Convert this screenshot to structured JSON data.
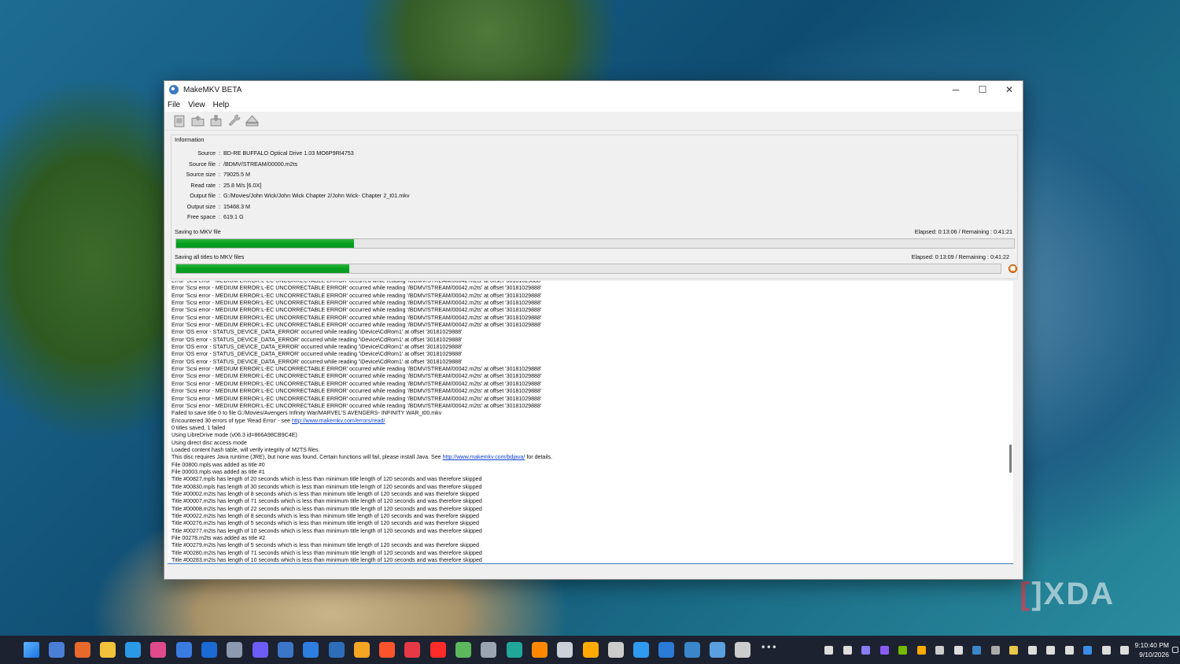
{
  "window": {
    "title": "MakeMKV BETA",
    "controls": {
      "minimize": "─",
      "maximize": "☐",
      "close": "✕"
    }
  },
  "menu": [
    "File",
    "View",
    "Help"
  ],
  "toolbar": [
    "open-disc-icon",
    "open-files-icon",
    "backup-icon",
    "preferences-icon",
    "eject-icon"
  ],
  "info": {
    "heading": "Information",
    "rows": [
      {
        "label": "Source",
        "value": "BD-RE BUFFALO Optical Drive 1.03 MO6P9RI4753"
      },
      {
        "label": "Source file",
        "value": "/BDMV/STREAM/00000.m2ts"
      },
      {
        "label": "Source size",
        "value": "79025.5 M"
      },
      {
        "label": "Read rate",
        "value": "25.8 M/s [6.0X]"
      },
      {
        "label": "Output file",
        "value": "G:/Movies/John Wick/John Wick Chapter 2/John Wick- Chapter 2_t01.mkv"
      },
      {
        "label": "Output size",
        "value": "15468.3 M"
      },
      {
        "label": "Free space",
        "value": "619.1 G"
      }
    ],
    "separator": ":"
  },
  "progress": [
    {
      "label": "Saving to MKV file",
      "time": "Elapsed: 0:13:06 / Remaining : 0:41:21",
      "fraction": 0.212
    },
    {
      "label": "Saving all titles to MKV files",
      "time": "Elapsed: 0:13:09 / Remaining : 0:41:22",
      "fraction": 0.21
    }
  ],
  "log": [
    "Error 'Scsi error - MEDIUM ERROR:L-EC UNCORRECTABLE ERROR' occurred while reading '/BDMV/STREAM/00042.m2ts' at offset '30181029888'",
    "Error 'Scsi error - MEDIUM ERROR:L-EC UNCORRECTABLE ERROR' occurred while reading '/BDMV/STREAM/00042.m2ts' at offset '30181029888'",
    "Error 'Scsi error - MEDIUM ERROR:L-EC UNCORRECTABLE ERROR' occurred while reading '/BDMV/STREAM/00042.m2ts' at offset '30181029888'",
    "Error 'Scsi error - MEDIUM ERROR:L-EC UNCORRECTABLE ERROR' occurred while reading '/BDMV/STREAM/00042.m2ts' at offset '30181029888'",
    "Error 'Scsi error - MEDIUM ERROR:L-EC UNCORRECTABLE ERROR' occurred while reading '/BDMV/STREAM/00042.m2ts' at offset '30181029888'",
    "Error 'Scsi error - MEDIUM ERROR:L-EC UNCORRECTABLE ERROR' occurred while reading '/BDMV/STREAM/00042.m2ts' at offset '30181029888'",
    "Error 'Scsi error - MEDIUM ERROR:L-EC UNCORRECTABLE ERROR' occurred while reading '/BDMV/STREAM/00042.m2ts' at offset '30181029888'",
    "Error 'OS error - STATUS_DEVICE_DATA_ERROR' occurred while reading '\\Device\\CdRom1' at offset '30181029888'",
    "Error 'OS error - STATUS_DEVICE_DATA_ERROR' occurred while reading '\\Device\\CdRom1' at offset '30181029888'",
    "Error 'OS error - STATUS_DEVICE_DATA_ERROR' occurred while reading '\\Device\\CdRom1' at offset '30181029888'",
    "Error 'OS error - STATUS_DEVICE_DATA_ERROR' occurred while reading '\\Device\\CdRom1' at offset '30181029888'",
    "Error 'OS error - STATUS_DEVICE_DATA_ERROR' occurred while reading '\\Device\\CdRom1' at offset '30181029888'",
    "Error 'Scsi error - MEDIUM ERROR:L-EC UNCORRECTABLE ERROR' occurred while reading '/BDMV/STREAM/00042.m2ts' at offset '30181029888'",
    "Error 'Scsi error - MEDIUM ERROR:L-EC UNCORRECTABLE ERROR' occurred while reading '/BDMV/STREAM/00042.m2ts' at offset '30181029888'",
    "Error 'Scsi error - MEDIUM ERROR:L-EC UNCORRECTABLE ERROR' occurred while reading '/BDMV/STREAM/00042.m2ts' at offset '30181029888'",
    "Error 'Scsi error - MEDIUM ERROR:L-EC UNCORRECTABLE ERROR' occurred while reading '/BDMV/STREAM/00042.m2ts' at offset '30181029888'",
    "Error 'Scsi error - MEDIUM ERROR:L-EC UNCORRECTABLE ERROR' occurred while reading '/BDMV/STREAM/00042.m2ts' at offset '30181029888'",
    "Error 'Scsi error - MEDIUM ERROR:L-EC UNCORRECTABLE ERROR' occurred while reading '/BDMV/STREAM/00042.m2ts' at offset '30181029888'",
    "Failed to save title 0 to file G:/Movies/Avengers Infinity War/MARVEL'S AVENGERS- INFINITY WAR_t00.mkv",
    "Encountered 30 errors of type 'Read Error' - see |http://www.makemkv.com/errors/read/",
    "0 titles saved, 1 failed",
    "Using LibreDrive mode (v06.3 id=866A98CB9C4E)",
    "Using direct disc access mode",
    "Loaded content hash table, will verify integrity of M2TS files.",
    "This disc requires Java runtime (JRE), but none was found. Certain functions will fail, please install Java. See |http://www.makemkv.com/bdjava/| for details.",
    "File 00800.mpls was added as title #0",
    "File 00003.mpls was added as title #1",
    "Title #00827.mpls has length of 20 seconds which is less than minimum title length of 120 seconds and was therefore skipped",
    "Title #00830.mpls has length of 30 seconds which is less than minimum title length of 120 seconds and was therefore skipped",
    "Title #00002.m2ts has length of 8 seconds which is less than minimum title length of 120 seconds and was therefore skipped",
    "Title #00007.m2ts has length of 71 seconds which is less than minimum title length of 120 seconds and was therefore skipped",
    "Title #00008.m2ts has length of 22 seconds which is less than minimum title length of 120 seconds and was therefore skipped",
    "Title #00022.m2ts has length of 8 seconds which is less than minimum title length of 120 seconds and was therefore skipped",
    "Title #00276.m2ts has length of 5 seconds which is less than minimum title length of 120 seconds and was therefore skipped",
    "Title #00277.m2ts has length of 10 seconds which is less than minimum title length of 120 seconds and was therefore skipped",
    "File 00278.m2ts was added as title #2",
    "Title #00279.m2ts has length of 5 seconds which is less than minimum title length of 120 seconds and was therefore skipped",
    "Title #00280.m2ts has length of 71 seconds which is less than minimum title length of 120 seconds and was therefore skipped",
    "Title #00283.m2ts has length of 10 seconds which is less than minimum title length of 120 seconds and was therefore skipped"
  ],
  "watermark": "XDA",
  "taskbar": {
    "apps": [
      "start-icon",
      "widgets-icon",
      "firefox-icon",
      "file-explorer-icon",
      "edge-icon",
      "slack-icon",
      "store-icon",
      "outlook-icon",
      "settings-icon",
      "messenger-icon",
      "calculator-icon",
      "notepad-icon",
      "terminal-icon",
      "app-icon",
      "brave-icon",
      "app-icon",
      "youtube-icon",
      "app-icon",
      "app-icon",
      "app-icon",
      "vlc-icon",
      "app-icon",
      "search-app-icon",
      "app-icon",
      "app-icon",
      "app-icon",
      "app-icon",
      "makemkv-icon",
      "app-icon",
      "more-icon"
    ],
    "app_colors": [
      "#3a8ee6",
      "#4a7fd6",
      "#e8692a",
      "#f2c33a",
      "#2b9ae6",
      "#e04a8c",
      "#3a7be0",
      "#1b6ad6",
      "#8d99ae",
      "#6d5cf5",
      "#3c76c8",
      "#2e7de0",
      "#2c6fb8",
      "#f4a623",
      "#fb542b",
      "#e63946",
      "#ff2a2a",
      "#5bb85d",
      "#9aa5b1",
      "#1fa79a",
      "#ff8800",
      "#c9d1d9",
      "#ffaa00",
      "#cccccc",
      "#2e9bf0",
      "#2a7ad6",
      "#3a86c8",
      "#5aa0e0",
      "#cccccc",
      "#dddddd"
    ],
    "tray": [
      "chevron-up-icon",
      "settings-tray-icon",
      "proton-icon",
      "app-tray-icon",
      "nvidia-icon",
      "search-tray-icon",
      "app-tray-icon",
      "app-tray-icon",
      "app-tray-icon",
      "app-tray-icon",
      "app-tray-icon",
      "display-icon",
      "app-tray-icon",
      "usb-icon",
      "bluetooth-icon",
      "network-icon",
      "volume-icon"
    ],
    "tray_colors": [
      "#dddddd",
      "#dddddd",
      "#8a7cf5",
      "#8a5cf5",
      "#76b900",
      "#ffaa00",
      "#cccccc",
      "#dddddd",
      "#3a86c8",
      "#aaaaaa",
      "#e6c84a",
      "#dddddd",
      "#dddddd",
      "#dddddd",
      "#3a8ee6",
      "#dddddd",
      "#dddddd"
    ],
    "time": "9:10:40 PM",
    "date": "9/10/2026"
  }
}
